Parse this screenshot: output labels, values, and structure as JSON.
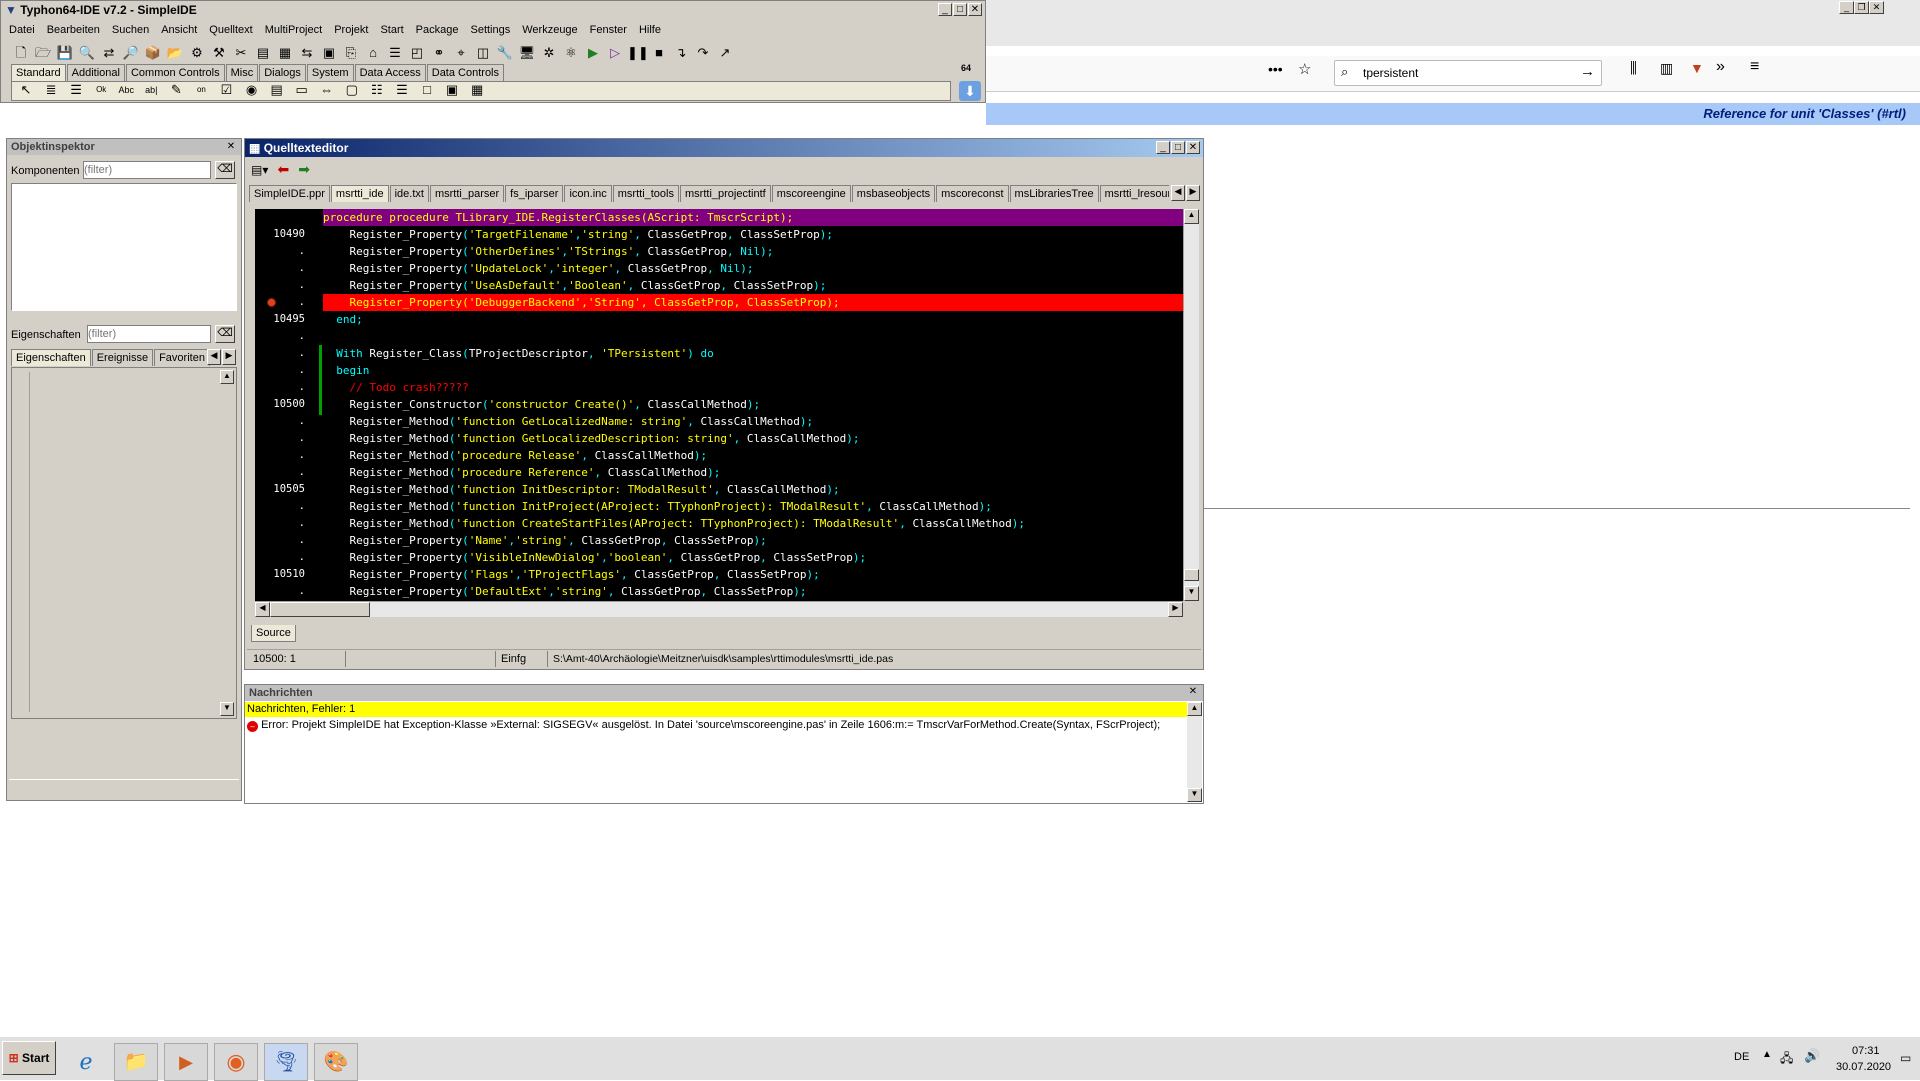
{
  "ide": {
    "title": "Typhon64-IDE v7.2 - SimpleIDE",
    "menu": [
      "Datei",
      "Bearbeiten",
      "Suchen",
      "Ansicht",
      "Quelltext",
      "MultiProject",
      "Projekt",
      "Start",
      "Package",
      "Settings",
      "Werkzeuge",
      "Fenster",
      "Hilfe"
    ],
    "palette_tabs": [
      "Standard",
      "Additional",
      "Common Controls",
      "Misc",
      "Dialogs",
      "System",
      "Data Access",
      "Data Controls"
    ],
    "palette_selected": "Standard",
    "palette_badge": "64"
  },
  "inspector": {
    "title": "Objektinspektor",
    "components_label": "Komponenten",
    "components_placeholder": "(filter)",
    "properties_label": "Eigenschaften",
    "properties_placeholder": "(filter)",
    "tabs": [
      "Eigenschaften",
      "Ereignisse",
      "Favoriten"
    ]
  },
  "editor": {
    "title": "Quelltexteditor",
    "tabs": [
      "SimpleIDE.ppr",
      "msrtti_ide",
      "ide.txt",
      "msrtti_parser",
      "fs_iparser",
      "icon.inc",
      "msrtti_tools",
      "msrtti_projectintf",
      "mscoreengine",
      "msbaseobjects",
      "mscoreconst",
      "msLibrariesTree",
      "msrtti_lresour"
    ],
    "selected_tab": "msrtti_ide",
    "header_line": "procedure TLibrary_IDE.RegisterClasses(AScript: TmscrScript);",
    "lines": [
      {
        "num": "10490",
        "code": "    Register_Property('TargetFilename','string', ClassGetProp, ClassSetProp);"
      },
      {
        "num": ".",
        "code": "    Register_Property('OtherDefines','TStrings', ClassGetProp, Nil);"
      },
      {
        "num": ".",
        "code": "    Register_Property('UpdateLock','integer', ClassGetProp, Nil);"
      },
      {
        "num": ".",
        "code": "    Register_Property('UseAsDefault','Boolean', ClassGetProp, ClassSetProp);"
      },
      {
        "num": ".",
        "code": "    Register_Property('DebuggerBackend','String', ClassGetProp, ClassSetProp);",
        "error": true
      },
      {
        "num": "10495",
        "code": "  end;"
      },
      {
        "num": ".",
        "code": ""
      },
      {
        "num": ".",
        "code": "  With Register_Class(TProjectDescriptor, 'TPersistent') do"
      },
      {
        "num": ".",
        "code": "  begin"
      },
      {
        "num": ".",
        "code": "    // Todo crash?????",
        "comment": true
      },
      {
        "num": "10500",
        "code": "    Register_Constructor('constructor Create()', ClassCallMethod);"
      },
      {
        "num": ".",
        "code": "    Register_Method('function GetLocalizedName: string', ClassCallMethod);"
      },
      {
        "num": ".",
        "code": "    Register_Method('function GetLocalizedDescription: string', ClassCallMethod);"
      },
      {
        "num": ".",
        "code": "    Register_Method('procedure Release', ClassCallMethod);"
      },
      {
        "num": ".",
        "code": "    Register_Method('procedure Reference', ClassCallMethod);"
      },
      {
        "num": "10505",
        "code": "    Register_Method('function InitDescriptor: TModalResult', ClassCallMethod);"
      },
      {
        "num": ".",
        "code": "    Register_Method('function InitProject(AProject: TTyphonProject): TModalResult', ClassCallMethod);"
      },
      {
        "num": ".",
        "code": "    Register_Method('function CreateStartFiles(AProject: TTyphonProject): TModalResult', ClassCallMethod);"
      },
      {
        "num": ".",
        "code": "    Register_Property('Name','string', ClassGetProp, ClassSetProp);"
      },
      {
        "num": ".",
        "code": "    Register_Property('VisibleInNewDialog','boolean', ClassGetProp, ClassSetProp);"
      },
      {
        "num": "10510",
        "code": "    Register_Property('Flags','TProjectFlags', ClassGetProp, ClassSetProp);"
      },
      {
        "num": ".",
        "code": "    Register_Property('DefaultExt','string', ClassGetProp, ClassSetProp);"
      }
    ],
    "source_tab": "Source",
    "status": {
      "pos": "10500:  1",
      "mode": "Einfg",
      "path": "S:\\Amt-40\\Archäologie\\Meitzner\\uisdk\\samples\\rttimodules\\msrtti_ide.pas"
    }
  },
  "messages": {
    "title": "Nachrichten",
    "summary": "Nachrichten, Fehler: 1",
    "error": "Error: Projekt SimpleIDE hat Exception-Klasse »External: SIGSEGV« ausgelöst. In Datei 'source\\mscoreengine.pas' in Zeile 1606:m:= TmscrVarForMethod.Create(Syntax, FScrProject);"
  },
  "browser": {
    "search_value": "tpersistent",
    "reference_text": "Reference for unit 'Classes' (#rtl)"
  },
  "taskbar": {
    "start_label": "Start",
    "lang": "DE",
    "time": "07:31",
    "date": "30.07.2020"
  },
  "colors": {
    "code_bg": "#000000",
    "error_line": "#ff0000",
    "header_line": "#800080",
    "reference_bg": "#a8c8f8"
  }
}
